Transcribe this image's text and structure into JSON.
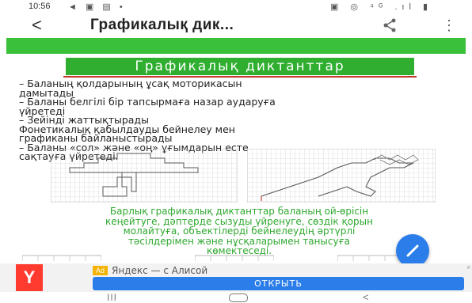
{
  "status_bar": {
    "time": "10:56",
    "left_icons": "◄ ▣ ▤ •",
    "right_icons": "▣ ◎ ⁴ᴳ .ıl ▮"
  },
  "app_bar": {
    "back_label": "<",
    "title": "Графикалық дик...",
    "more_label": "⋮"
  },
  "article": {
    "banner": "Графикалық диктанттар",
    "list_lines": [
      "– Баланың қолдарының ұсақ моторикасын",
      "дамытады",
      "– Баланы белгілі бір тапсырмаға назар аударуға",
      "үйретеді",
      "– Зейінді жаттықтырады",
      "Фонетикалық қабылдауды бейнелеу мен",
      "графиканы байланыстырады",
      "– Баланы «сол» және «оң» ұғымдарын есте",
      "сақтауға үйретеді."
    ],
    "green_lines": [
      "Барлық графикалық диктанттар баланың ой-өрісін",
      "кеңейтуге, дәптерде сызуды үйренуге, сөздік қорын",
      "молайтуға, объектілерді бейнелеудің әртүрлі",
      "тәсілдерімен және нұсқаларымен танысуға",
      "көмектеседі."
    ]
  },
  "ad": {
    "logo_letter": "Y",
    "tag": "Ad",
    "title": "Яндекс — с Алисой",
    "button": "ОТКРЫТЬ",
    "close": "×"
  },
  "nav": {
    "recent": "III",
    "back": "<"
  },
  "colors": {
    "green": "#3bc03b",
    "banner_green": "#2fae2f",
    "text_green": "#2ea82e",
    "accent_blue": "#2b7de9"
  }
}
